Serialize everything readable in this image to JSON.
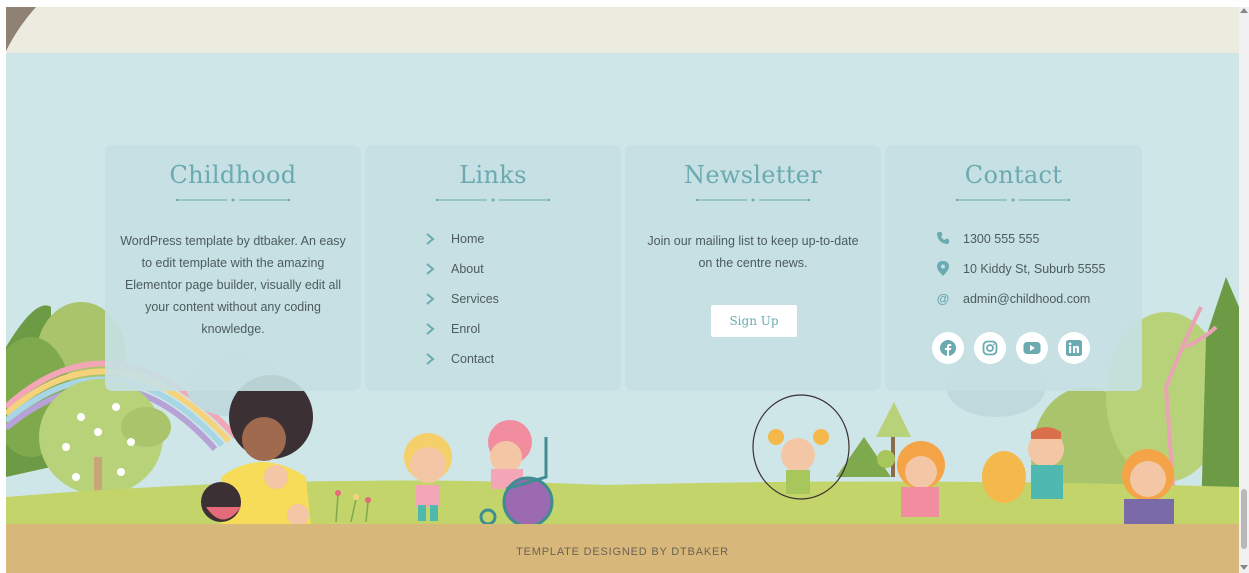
{
  "about": {
    "title": "Childhood",
    "text": "WordPress template by dtbaker. An easy to edit template with the amazing Elementor page builder, visually edit all your content without any coding knowledge."
  },
  "links": {
    "title": "Links",
    "items": [
      {
        "label": "Home",
        "icon": "chevron-right-icon"
      },
      {
        "label": "About",
        "icon": "chevron-right-icon"
      },
      {
        "label": "Services",
        "icon": "chevron-right-icon"
      },
      {
        "label": "Enrol",
        "icon": "chevron-right-icon"
      },
      {
        "label": "Contact",
        "icon": "chevron-right-icon"
      }
    ]
  },
  "newsletter": {
    "title": "Newsletter",
    "text": "Join our mailing list to keep up-to-date on the centre news.",
    "button": "Sign Up"
  },
  "contact": {
    "title": "Contact",
    "phone": "1300 555 555",
    "address": "10 Kiddy St, Suburb 5555",
    "email": "admin@childhood.com",
    "icons": [
      "phone-icon",
      "map-pin-icon",
      "at-sign-icon"
    ],
    "socials": [
      "facebook-icon",
      "instagram-icon",
      "youtube-icon",
      "linkedin-icon"
    ]
  },
  "footer": {
    "credit": "TEMPLATE DESIGNED BY DTBAKER"
  },
  "colors": {
    "accent": "#6aaab0",
    "background": "#cfe6e8",
    "ground": "#d8b77a",
    "text": "#4e5b5d"
  }
}
